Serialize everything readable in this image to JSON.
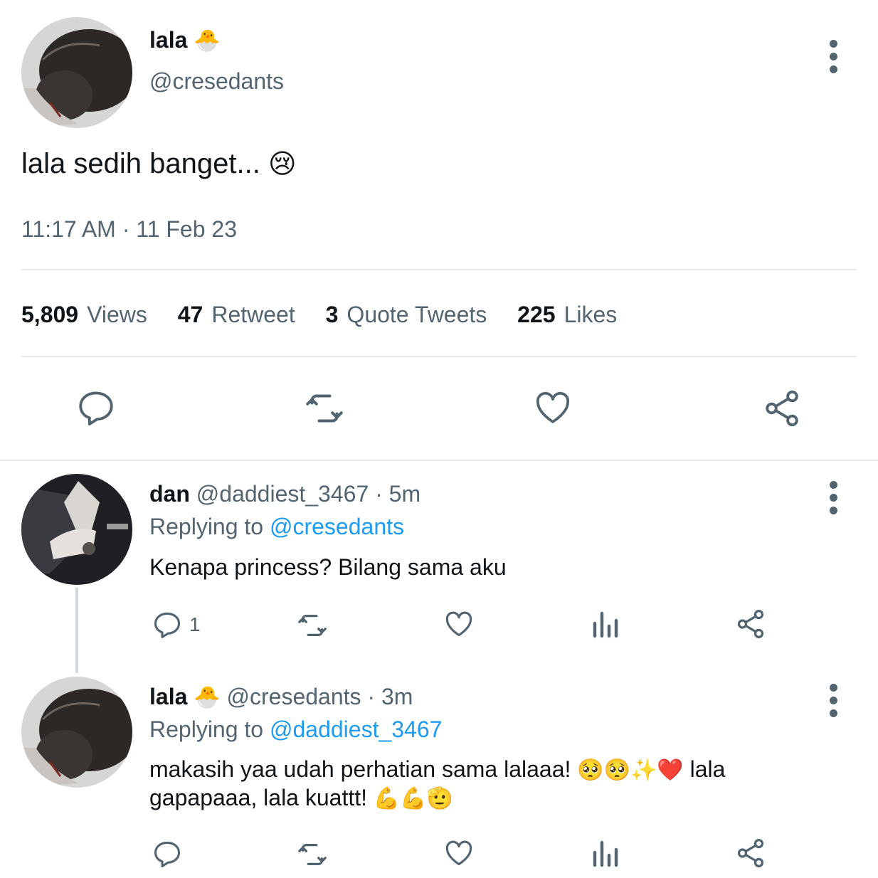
{
  "main_tweet": {
    "author": {
      "name": "lala",
      "name_emoji": "🐣",
      "handle": "@cresedants"
    },
    "text": "lala sedih banget...",
    "text_emoji": "😢",
    "timestamp": "11:17 AM · 11 Feb 23",
    "stats": [
      {
        "num": "5,809",
        "label": "Views"
      },
      {
        "num": "47",
        "label": "Retweet"
      },
      {
        "num": "3",
        "label": "Quote Tweets"
      },
      {
        "num": "225",
        "label": "Likes"
      }
    ],
    "actions": [
      "reply-icon",
      "retweet-icon",
      "like-icon",
      "share-icon"
    ]
  },
  "replies": [
    {
      "name": "dan",
      "handle": "@daddiest_3467",
      "time": "· 5m",
      "replying_prefix": "Replying to",
      "replying_to": "@cresedants",
      "line1": "Kenapa princess? Bilang sama aku",
      "reply_count": "1"
    },
    {
      "name": "lala",
      "name_emoji": "🐣",
      "handle": "@cresedants",
      "time": "· 3m",
      "replying_prefix": "Replying to",
      "replying_to": "@daddiest_3467",
      "line1": "makasih yaa udah perhatian sama lalaaa!",
      "line1_emoji": "🥺🥺✨❤️",
      "line1_tail": "lala",
      "line2": "gapapaaa, lala kuattt!",
      "line2_emoji": "💪💪🫡"
    }
  ],
  "colors": {
    "text": "#0f1419",
    "secondary": "#536471",
    "link": "#1d9bf0",
    "divider": "#e7e9ea"
  }
}
